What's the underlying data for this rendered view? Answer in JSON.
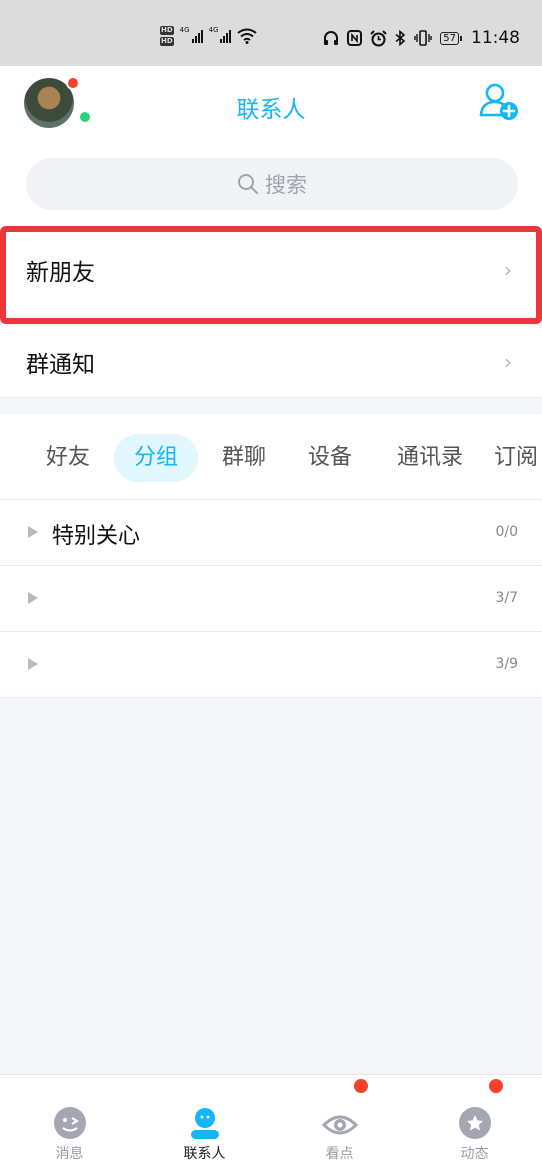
{
  "status_bar": {
    "hd_labels": [
      "HD",
      "HD"
    ],
    "sim_labels": [
      "4G",
      "4G"
    ],
    "battery": "57",
    "time": "11:48",
    "icons": [
      "headphones-icon",
      "nfc-icon",
      "alarm-icon",
      "bluetooth-icon",
      "vibrate-icon"
    ]
  },
  "header": {
    "title": "联系人",
    "accent_color": "#12b7f5"
  },
  "search": {
    "placeholder": "搜索"
  },
  "entries": {
    "new_friends": "新朋友",
    "group_notice": "群通知",
    "chevron": "›"
  },
  "tabs": [
    {
      "label": "好友"
    },
    {
      "label": "分组",
      "active": true
    },
    {
      "label": "群聊"
    },
    {
      "label": "设备"
    },
    {
      "label": "通讯录"
    },
    {
      "label": "订阅"
    }
  ],
  "groups": [
    {
      "name": "特别关心",
      "count": "0/0"
    },
    {
      "name": "",
      "count": "3/7"
    },
    {
      "name": "",
      "count": "3/9"
    }
  ],
  "tabbar": [
    {
      "label": "消息",
      "icon": "message-icon",
      "badge": false
    },
    {
      "label": "联系人",
      "icon": "contacts-icon",
      "active": true,
      "badge": false
    },
    {
      "label": "看点",
      "icon": "eye-icon",
      "badge": true
    },
    {
      "label": "动态",
      "icon": "star-icon",
      "badge": true
    }
  ]
}
